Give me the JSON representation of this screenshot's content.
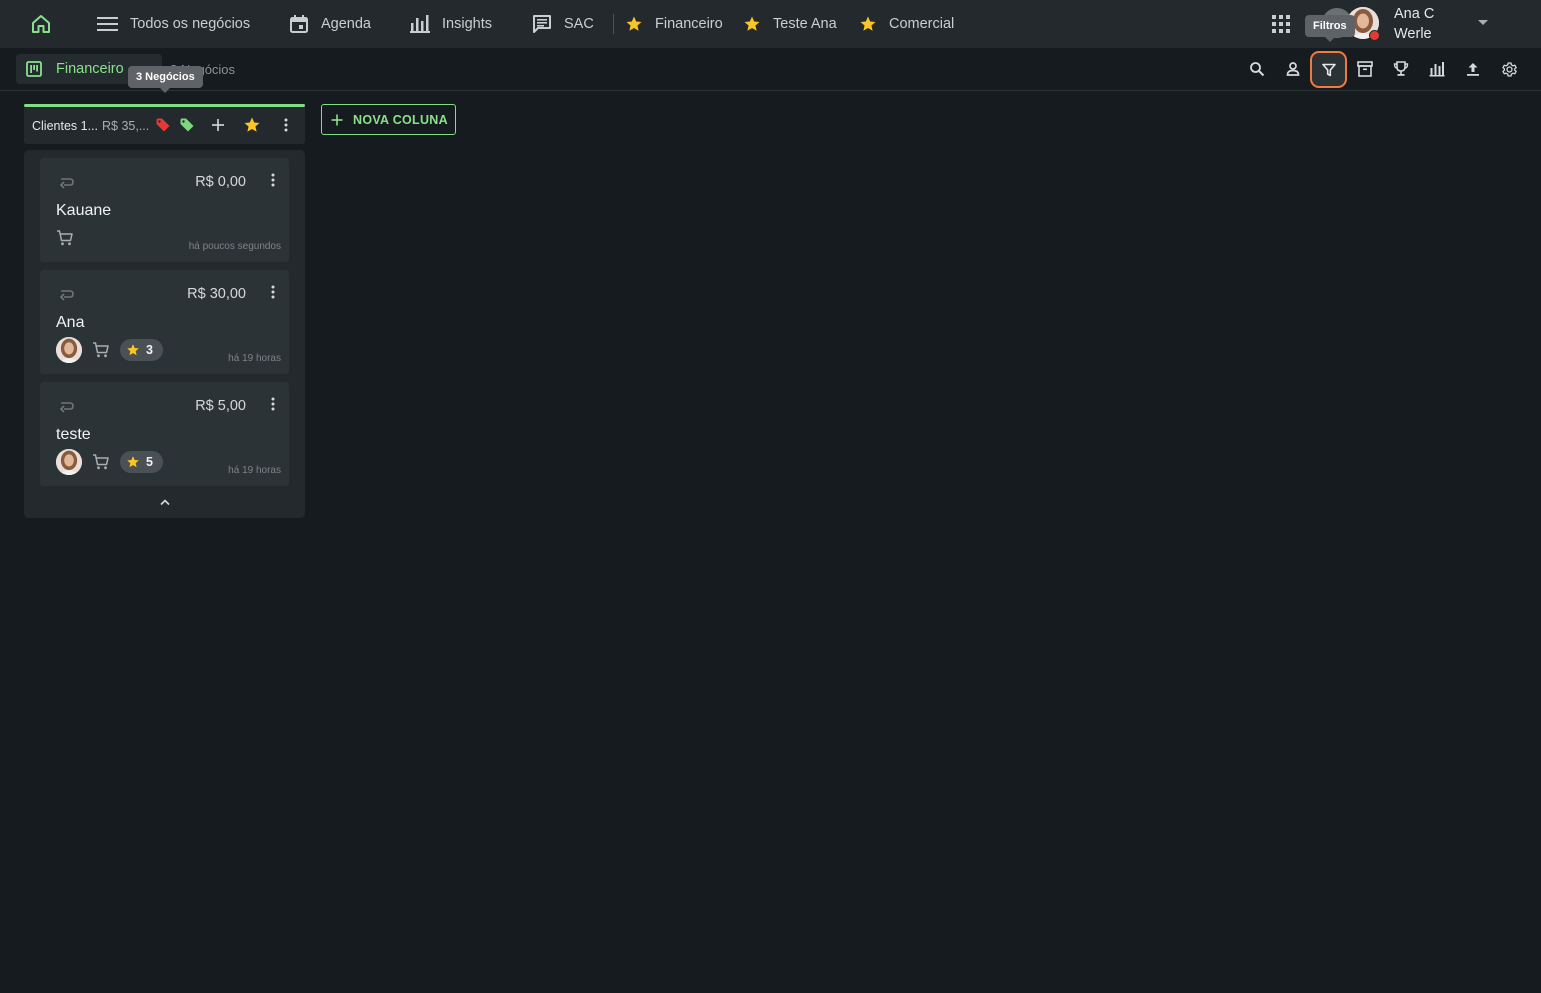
{
  "topnav": {
    "items": [
      {
        "label": "Todos os negócios",
        "icon": "menu-icon"
      },
      {
        "label": "Agenda",
        "icon": "calendar-icon"
      },
      {
        "label": "Insights",
        "icon": "bar-chart-icon"
      },
      {
        "label": "SAC",
        "icon": "chat-icon"
      },
      {
        "label": "Financeiro",
        "icon": "star-icon"
      },
      {
        "label": "Teste Ana",
        "icon": "star-icon"
      },
      {
        "label": "Comercial",
        "icon": "star-icon"
      }
    ],
    "user": {
      "first_line": "Ana C",
      "second_line": "Werle"
    }
  },
  "tooltips": {
    "filter": "Filtros",
    "column_count": "3 Negócios"
  },
  "subbar": {
    "active_tab": "Financeiro",
    "subtitle": "3 Negócios",
    "toolbar_icons": [
      "search-icon",
      "person-icon",
      "filter-icon",
      "archive-icon",
      "trophy-icon",
      "bar-chart-icon",
      "upload-icon",
      "settings-icon"
    ]
  },
  "column": {
    "title": "Clientes 1...",
    "value": "R$ 35,...",
    "cards": [
      {
        "value": "R$ 0,00",
        "name": "Kauane",
        "time": "há poucos segundos",
        "has_avatar": false,
        "stars": null
      },
      {
        "value": "R$ 30,00",
        "name": "Ana",
        "time": "há 19 horas",
        "has_avatar": true,
        "stars": "3"
      },
      {
        "value": "R$ 5,00",
        "name": "teste",
        "time": "há 19 horas",
        "has_avatar": true,
        "stars": "5"
      }
    ]
  },
  "new_column_label": "NOVA COLUNA",
  "colors": {
    "accent_green": "#82de82",
    "star_yellow": "#f9c623",
    "highlight_orange": "#f07b3f",
    "tag_red": "#e53935",
    "tag_green": "#7bd87b"
  }
}
